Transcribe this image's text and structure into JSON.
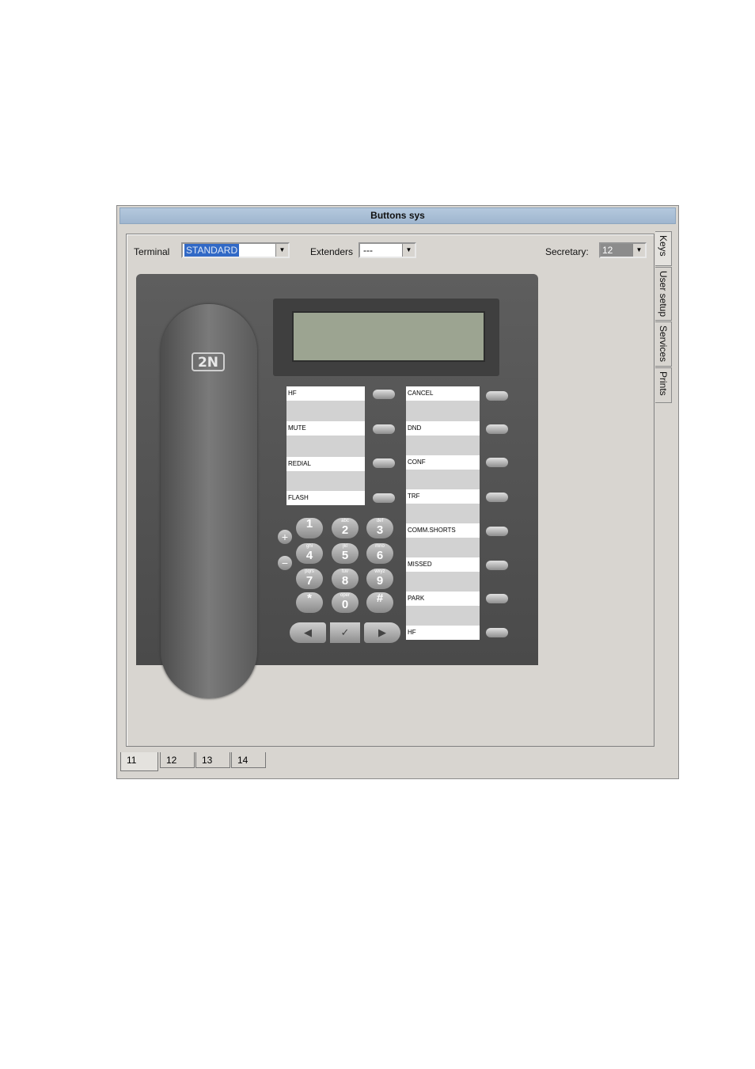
{
  "window": {
    "title": "Buttons sys"
  },
  "toolbar": {
    "terminal_label": "Terminal",
    "terminal_value": "STANDARD",
    "extenders_label": "Extenders",
    "extenders_value": "---",
    "secretary_label": "Secretary:",
    "secretary_value": "12"
  },
  "side_tabs": [
    "Keys",
    "User setup",
    "Services",
    "Prints"
  ],
  "bottom_tabs": [
    "11",
    "12",
    "13",
    "14"
  ],
  "phone": {
    "logo": "2N",
    "left_keys": [
      "HF",
      "MUTE",
      "REDIAL",
      "FLASH"
    ],
    "right_keys": [
      "CANCEL",
      "DND",
      "CONF",
      "TRF",
      "COMM.SHORTS",
      "MISSED",
      "PARK",
      "HF"
    ],
    "dialpad": [
      {
        "letters": "",
        "num": "1"
      },
      {
        "letters": "abc",
        "num": "2"
      },
      {
        "letters": "def",
        "num": "3"
      },
      {
        "letters": "ghi",
        "num": "4"
      },
      {
        "letters": "jkl",
        "num": "5"
      },
      {
        "letters": "mno",
        "num": "6"
      },
      {
        "letters": "pqrs",
        "num": "7"
      },
      {
        "letters": "tuv",
        "num": "8"
      },
      {
        "letters": "wxyz",
        "num": "9"
      },
      {
        "letters": "",
        "num": "*"
      },
      {
        "letters": "oper",
        "num": "0"
      },
      {
        "letters": "",
        "num": "#"
      }
    ],
    "volume_plus": "+",
    "volume_minus": "−",
    "nav_left": "◀",
    "nav_ok": "✓",
    "nav_right": "▶"
  }
}
